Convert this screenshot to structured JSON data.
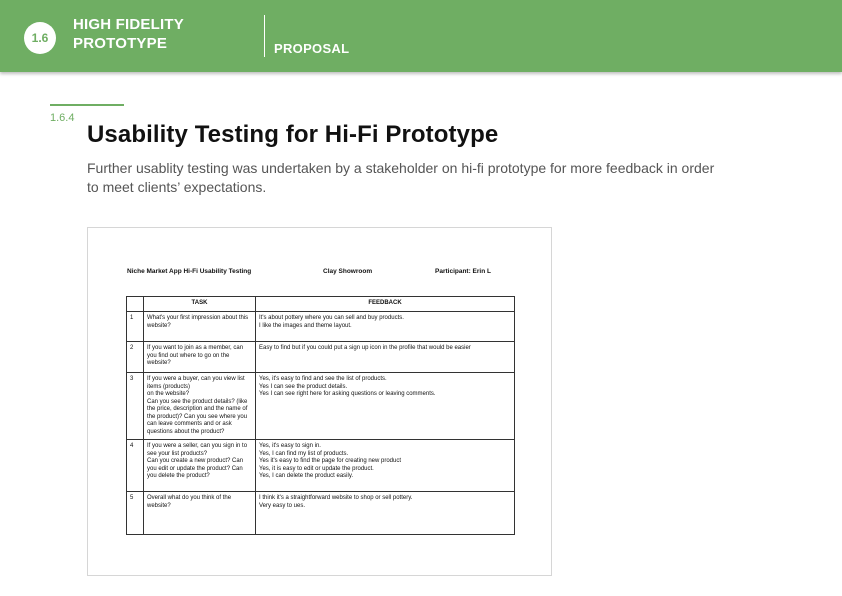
{
  "header": {
    "badge": "1.6",
    "section_title_line1": "HIGH FIDELITY",
    "section_title_line2": "PROTOTYPE",
    "section_tag": "PROPOSAL",
    "bg_color": "#6fae63"
  },
  "content": {
    "sub_number": "1.6.4",
    "title": "Usability Testing for Hi-Fi Prototype",
    "description": "Further usablity testing was undertaken by a stakeholder on hi-fi prototype for more feedback in order to meet clients’ expectations."
  },
  "document": {
    "heading": "Niche Market App Hi-Fi Usability Testing",
    "location": "Clay Showroom",
    "participant": "Participant: Erin L",
    "columns": [
      "",
      "TASK",
      "FEEDBACK"
    ],
    "rows": [
      {
        "num": "1",
        "task": "What's your first impression about this website?",
        "feedback": "It's about pottery where you can sell and buy products.\nI like the images and theme layout."
      },
      {
        "num": "2",
        "task": "If you want to join as a member, can you find out where to go on the website?",
        "feedback": "Easy to find but if you could put a sign up icon in the profile that would be easier"
      },
      {
        "num": "3",
        "task": "If you were a buyer, can you view list items (products)\non the website?\nCan you see the product details? (like the price, description and the name of the product)? Can you see where you can leave comments and or ask questions about the product?",
        "feedback": "Yes, it's easy to find and see the list of products.\nYes I can see the product details.\nYes I can see right here for asking questions or leaving comments."
      },
      {
        "num": "4",
        "task": "If you were a seller, can you sign in to see your list products?\nCan you create a new product? Can you edit or update the product? Can you delete the product?",
        "feedback": "Yes, it's easy to sign in.\nYes, I can find my list of products.\nYes it's easy to find the page for creating new product\nYes, it is easy to edit or update the product.\nYes, I can delete the product easily."
      },
      {
        "num": "5",
        "task": "Overall what do you think of the website?",
        "feedback": "I think it's a straightforward website to shop or sell pottery.\nVery easy to ues."
      }
    ]
  }
}
